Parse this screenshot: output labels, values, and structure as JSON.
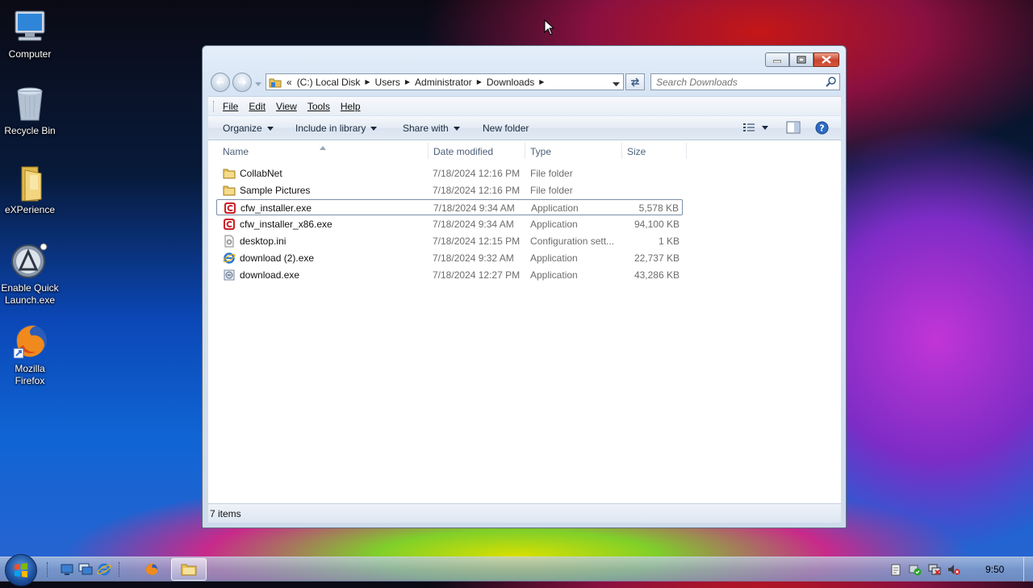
{
  "desktop": {
    "icons": [
      {
        "label": "Computer",
        "icon": "computer-icon"
      },
      {
        "label": "Recycle Bin",
        "icon": "recycle-bin-icon"
      },
      {
        "label": "eXPerience",
        "icon": "folder-icon"
      },
      {
        "label_line1": "Enable Quick",
        "label_line2": "Launch.exe",
        "icon": "quick-launch-icon"
      },
      {
        "label_line1": "Mozilla",
        "label_line2": "Firefox",
        "icon": "firefox-icon"
      }
    ]
  },
  "window": {
    "address": {
      "overflow": "«",
      "crumbs": [
        "(C:) Local Disk",
        "Users",
        "Administrator",
        "Downloads"
      ]
    },
    "search_placeholder": "Search Downloads",
    "menu": [
      "File",
      "Edit",
      "View",
      "Tools",
      "Help"
    ],
    "commands": {
      "organize": "Organize",
      "include": "Include in library",
      "share": "Share with",
      "new_folder": "New folder"
    },
    "columns": {
      "name": "Name",
      "date": "Date modified",
      "type": "Type",
      "size": "Size"
    },
    "files": [
      {
        "name": "CollabNet",
        "date": "7/18/2024 12:16 PM",
        "type": "File folder",
        "size": "",
        "icon": "folder-icon"
      },
      {
        "name": "Sample Pictures",
        "date": "7/18/2024 12:16 PM",
        "type": "File folder",
        "size": "",
        "icon": "folder-icon"
      },
      {
        "name": "cfw_installer.exe",
        "date": "7/18/2024 9:34 AM",
        "type": "Application",
        "size": "5,578 KB",
        "icon": "cfw-app-icon"
      },
      {
        "name": "cfw_installer_x86.exe",
        "date": "7/18/2024 9:34 AM",
        "type": "Application",
        "size": "94,100 KB",
        "icon": "cfw-app-icon"
      },
      {
        "name": "desktop.ini",
        "date": "7/18/2024 12:15 PM",
        "type": "Configuration sett...",
        "size": "1 KB",
        "icon": "settings-file-icon"
      },
      {
        "name": "download (2).exe",
        "date": "7/18/2024 9:32 AM",
        "type": "Application",
        "size": "22,737 KB",
        "icon": "ie-app-icon"
      },
      {
        "name": "download.exe",
        "date": "7/18/2024 12:27 PM",
        "type": "Application",
        "size": "43,286 KB",
        "icon": "setup-app-icon"
      }
    ],
    "status": "7 items"
  },
  "taskbar": {
    "clock": "9:50"
  },
  "colors": {
    "cfw_red": "#c8232c",
    "folder_yellow": "#e8c25a",
    "close_red": "#c8442d"
  }
}
